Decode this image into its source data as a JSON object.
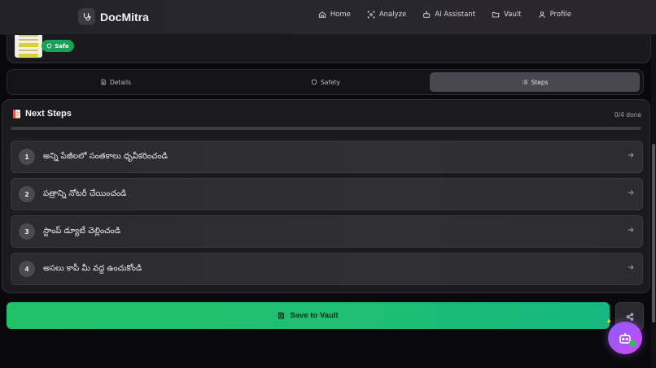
{
  "brand": {
    "name": "DocMitra",
    "icon": "stethoscope-icon"
  },
  "nav": {
    "items": [
      {
        "label": "Home",
        "icon": "home-icon"
      },
      {
        "label": "Analyze",
        "icon": "scan-icon"
      },
      {
        "label": "AI Assistant",
        "icon": "bot-icon"
      },
      {
        "label": "Vault",
        "icon": "folder-icon"
      },
      {
        "label": "Profile",
        "icon": "user-icon"
      }
    ]
  },
  "document": {
    "status": "Safe",
    "status_color": "#15a35a"
  },
  "tabs": [
    {
      "label": "Details",
      "icon": "file-icon",
      "active": false
    },
    {
      "label": "Safety",
      "icon": "shield-icon",
      "active": false
    },
    {
      "label": "Steps",
      "icon": "list-icon",
      "active": true
    }
  ],
  "steps_panel": {
    "title": "Next Steps",
    "count": "0/4 done",
    "progress": 0,
    "steps": [
      {
        "number": "1",
        "text": "అన్ని పేజీలలో సంతకాలు ధృవీకరించండి"
      },
      {
        "number": "2",
        "text": "పత్రాన్ని నోటరీ చేయించండి"
      },
      {
        "number": "3",
        "text": "స్టాంప్ డ్యూటీ చెల్లించండి"
      },
      {
        "number": "4",
        "text": "అసలు కాపీ మీ వద్ద ఉంచుకోండి"
      }
    ]
  },
  "actions": {
    "save_label": "Save to Vault",
    "accent": "#20c169"
  }
}
